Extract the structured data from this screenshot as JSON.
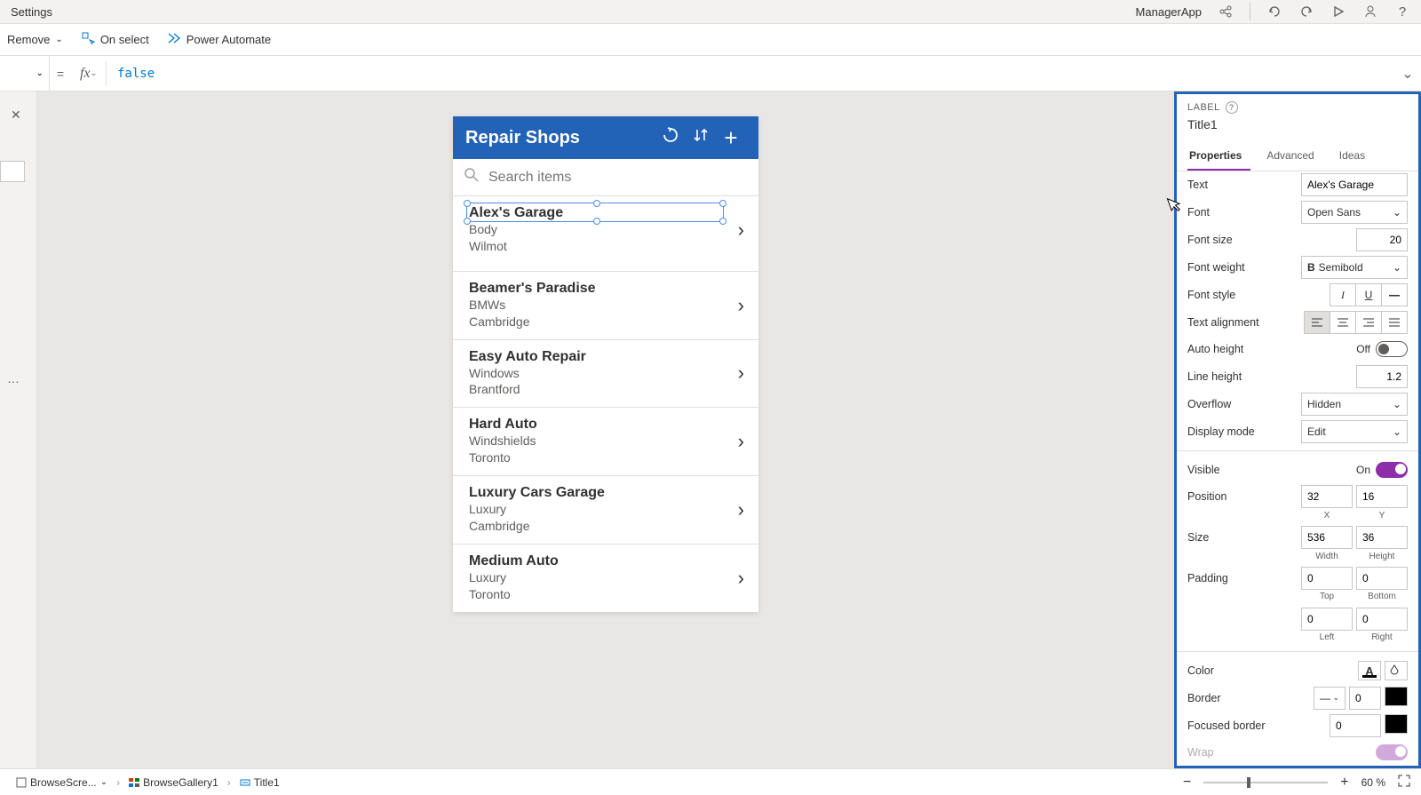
{
  "titlebar": {
    "title": "Settings",
    "appName": "ManagerApp"
  },
  "commandbar": {
    "remove": "Remove",
    "onSelect": "On select",
    "powerAutomate": "Power Automate"
  },
  "formula": {
    "value": "false"
  },
  "canvas": {
    "appTitle": "Repair Shops",
    "searchPlaceholder": "Search items",
    "items": [
      {
        "title": "Alex's Garage",
        "sub1": "Body",
        "sub2": "Wilmot"
      },
      {
        "title": "Beamer's Paradise",
        "sub1": "BMWs",
        "sub2": "Cambridge"
      },
      {
        "title": "Easy Auto Repair",
        "sub1": "Windows",
        "sub2": "Brantford"
      },
      {
        "title": "Hard Auto",
        "sub1": "Windshields",
        "sub2": "Toronto"
      },
      {
        "title": "Luxury Cars Garage",
        "sub1": "Luxury",
        "sub2": "Cambridge"
      },
      {
        "title": "Medium Auto",
        "sub1": "Luxury",
        "sub2": "Toronto"
      }
    ]
  },
  "props": {
    "typeLabel": "LABEL",
    "controlName": "Title1",
    "tabs": {
      "properties": "Properties",
      "advanced": "Advanced",
      "ideas": "Ideas"
    },
    "fields": {
      "text": {
        "label": "Text",
        "value": "Alex's Garage"
      },
      "font": {
        "label": "Font",
        "value": "Open Sans"
      },
      "fontSize": {
        "label": "Font size",
        "value": "20"
      },
      "fontWeight": {
        "label": "Font weight",
        "value": "Semibold"
      },
      "fontStyle": {
        "label": "Font style"
      },
      "textAlign": {
        "label": "Text alignment"
      },
      "autoHeight": {
        "label": "Auto height",
        "state": "Off"
      },
      "lineHeight": {
        "label": "Line height",
        "value": "1.2"
      },
      "overflow": {
        "label": "Overflow",
        "value": "Hidden"
      },
      "displayMode": {
        "label": "Display mode",
        "value": "Edit"
      },
      "visible": {
        "label": "Visible",
        "state": "On"
      },
      "position": {
        "label": "Position",
        "x": "32",
        "y": "16",
        "xLabel": "X",
        "yLabel": "Y"
      },
      "size": {
        "label": "Size",
        "w": "536",
        "h": "36",
        "wLabel": "Width",
        "hLabel": "Height"
      },
      "padding": {
        "label": "Padding",
        "top": "0",
        "bottom": "0",
        "left": "0",
        "right": "0",
        "topLabel": "Top",
        "bottomLabel": "Bottom",
        "leftLabel": "Left",
        "rightLabel": "Right"
      },
      "color": {
        "label": "Color"
      },
      "border": {
        "label": "Border",
        "width": "0"
      },
      "focusedBorder": {
        "label": "Focused border",
        "width": "0"
      },
      "wrap": {
        "label": "Wrap"
      }
    }
  },
  "statusbar": {
    "bc1": "BrowseScre...",
    "bc2": "BrowseGallery1",
    "bc3": "Title1",
    "zoom": "60",
    "zoomPct": "%"
  }
}
